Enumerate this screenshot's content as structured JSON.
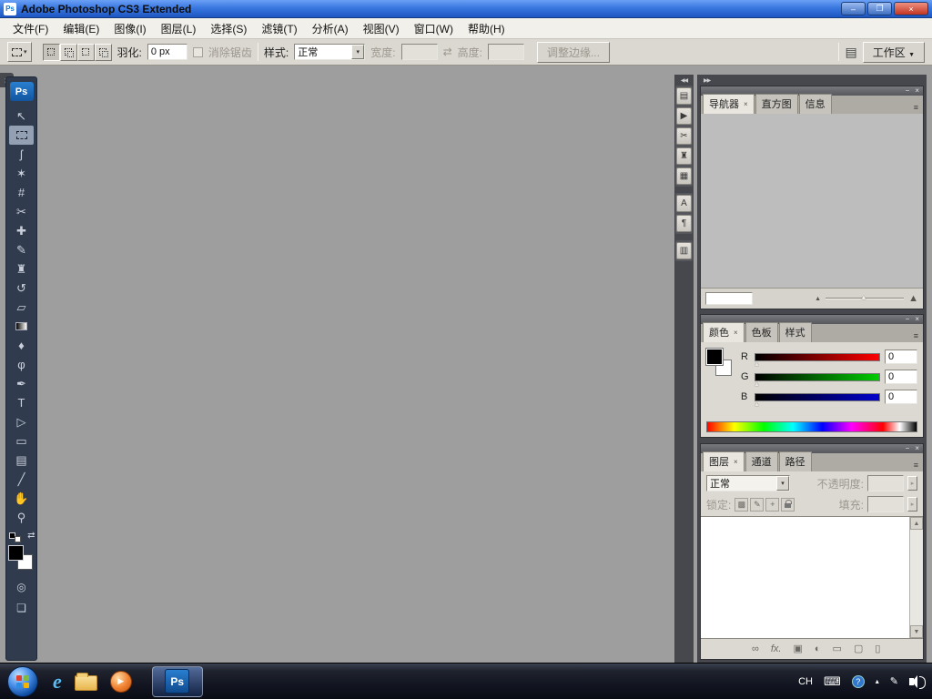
{
  "window": {
    "title": "Adobe Photoshop CS3 Extended",
    "app_icon_text": "Ps",
    "minimize_glyph": "–",
    "maximize_glyph": "❐",
    "close_glyph": "×"
  },
  "menu_bar": {
    "items": [
      "文件(F)",
      "编辑(E)",
      "图像(I)",
      "图层(L)",
      "选择(S)",
      "滤镜(T)",
      "分析(A)",
      "视图(V)",
      "窗口(W)",
      "帮助(H)"
    ]
  },
  "options_bar": {
    "tool_preset_arrow": "▾",
    "feather_label": "羽化:",
    "feather_value": "0 px",
    "antialias_label": "消除锯齿",
    "style_label": "样式:",
    "style_value": "正常",
    "style_arrow": "▾",
    "width_label": "宽度:",
    "width_value": "",
    "swap_glyph": "⇄",
    "height_label": "高度:",
    "height_value": "",
    "refine_edge_label": "调整边缘...",
    "palettes_toggle_glyph": "▤",
    "workspace_label": "工作区",
    "workspace_arrow": "▼"
  },
  "toolbox": {
    "expand_glyph": "»",
    "logo_text": "Ps",
    "tools": [
      {
        "id": "move",
        "glyph": "↖"
      },
      {
        "id": "rectangular-marquee",
        "glyph": ""
      },
      {
        "id": "lasso",
        "glyph": "ʃ"
      },
      {
        "id": "quick-selection",
        "glyph": "✶"
      },
      {
        "id": "crop",
        "glyph": "#"
      },
      {
        "id": "slice",
        "glyph": "✂"
      },
      {
        "id": "healing-brush",
        "glyph": "✚"
      },
      {
        "id": "brush",
        "glyph": "✎"
      },
      {
        "id": "clone-stamp",
        "glyph": "♜"
      },
      {
        "id": "history-brush",
        "glyph": "↺"
      },
      {
        "id": "eraser",
        "glyph": "▱"
      },
      {
        "id": "gradient",
        "glyph": ""
      },
      {
        "id": "blur",
        "glyph": "♦"
      },
      {
        "id": "dodge",
        "glyph": "φ"
      },
      {
        "id": "pen",
        "glyph": "✒"
      },
      {
        "id": "type",
        "glyph": "T"
      },
      {
        "id": "path-selection",
        "glyph": "▷"
      },
      {
        "id": "rectangle",
        "glyph": "▭"
      },
      {
        "id": "notes",
        "glyph": "▤"
      },
      {
        "id": "eyedropper",
        "glyph": "╱"
      },
      {
        "id": "hand",
        "glyph": "✋"
      },
      {
        "id": "zoom",
        "glyph": "⚲"
      }
    ],
    "swap_colors_glyph": "⇄",
    "quick_mask_glyph": "◎",
    "screen_mode_glyph": "❏",
    "foreground_color": "#000000",
    "background_color": "#ffffff"
  },
  "icon_strip": {
    "collapse_glyph": "◀◀",
    "group1": [
      {
        "id": "tool-presets",
        "glyph": "▤"
      },
      {
        "id": "actions",
        "glyph": "▶"
      },
      {
        "id": "tools",
        "glyph": "✂"
      },
      {
        "id": "clone-source",
        "glyph": "♜"
      },
      {
        "id": "animation",
        "glyph": "▦"
      }
    ],
    "group2": [
      {
        "id": "character",
        "glyph": "A"
      },
      {
        "id": "paragraph",
        "glyph": "¶"
      }
    ],
    "group3": [
      {
        "id": "layer-comps",
        "glyph": "▥"
      }
    ]
  },
  "dock": {
    "collapse_glyph": "▶▶",
    "navigator_group": {
      "minimize_glyph": "−",
      "close_glyph": "×",
      "menu_glyph": "≡",
      "tabs": [
        {
          "label": "导航器",
          "close": "×"
        },
        {
          "label": "直方图"
        },
        {
          "label": "信息"
        }
      ],
      "zoom_value": "",
      "zoom_out_glyph": "▲",
      "zoom_in_glyph": "▲",
      "thumb_glyph": "▲"
    },
    "color_group": {
      "minimize_glyph": "−",
      "close_glyph": "×",
      "menu_glyph": "≡",
      "tabs": [
        {
          "label": "颜色",
          "close": "×"
        },
        {
          "label": "色板"
        },
        {
          "label": "样式"
        }
      ],
      "channels": [
        {
          "label": "R",
          "value": "0",
          "thumb": "▲"
        },
        {
          "label": "G",
          "value": "0",
          "thumb": "▲"
        },
        {
          "label": "B",
          "value": "0",
          "thumb": "▲"
        }
      ]
    },
    "layers_group": {
      "minimize_glyph": "−",
      "close_glyph": "×",
      "menu_glyph": "≡",
      "tabs": [
        {
          "label": "图层",
          "close": "×"
        },
        {
          "label": "通道"
        },
        {
          "label": "路径"
        }
      ],
      "blend_mode_value": "正常",
      "blend_mode_arrow": "▾",
      "opacity_label": "不透明度:",
      "opacity_value": "",
      "opacity_spin": "▸",
      "lock_label": "锁定:",
      "lock_icons": [
        {
          "id": "lock-transparent",
          "glyph": "▩"
        },
        {
          "id": "lock-image",
          "glyph": "✎"
        },
        {
          "id": "lock-position",
          "glyph": "+"
        },
        {
          "id": "lock-all",
          "glyph": ""
        }
      ],
      "fill_label": "填充:",
      "fill_value": "",
      "fill_spin": "▸",
      "scroll_up_glyph": "▲",
      "scroll_down_glyph": "▼",
      "buttons": [
        {
          "id": "link-layers",
          "glyph": "∞"
        },
        {
          "id": "layer-style",
          "glyph": "fx."
        },
        {
          "id": "layer-mask",
          "glyph": "▣"
        },
        {
          "id": "adjustment-layer",
          "glyph": "◐"
        },
        {
          "id": "new-group",
          "glyph": "▭"
        },
        {
          "id": "new-layer",
          "glyph": "▢"
        },
        {
          "id": "delete-layer",
          "glyph": "▯"
        }
      ]
    }
  },
  "taskbar": {
    "ps_button_text": "Ps",
    "wmp_glyph": "▶",
    "ie_glyph": "e",
    "tray": {
      "language": "CH",
      "keyboard_glyph": "⌨",
      "help_glyph": "?",
      "hidden_icons_glyph": "▴",
      "pen_glyph": "✎"
    }
  }
}
